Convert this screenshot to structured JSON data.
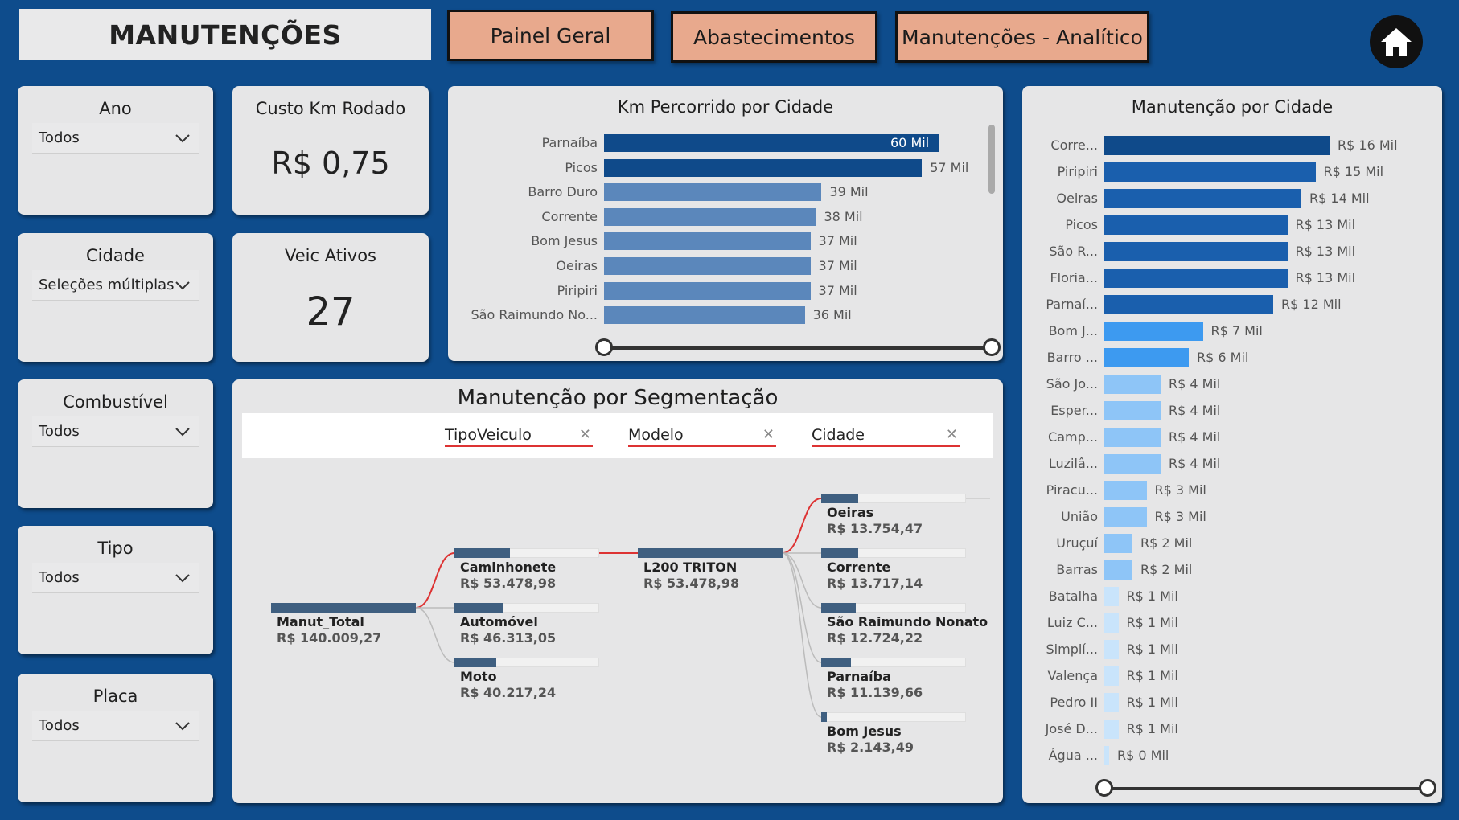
{
  "header": {
    "title": "MANUTENÇÕES",
    "nav": [
      "Painel Geral",
      "Abastecimentos",
      "Manutenções - Analítico"
    ]
  },
  "slicers": [
    {
      "title": "Ano",
      "value": "Todos"
    },
    {
      "title": "Cidade",
      "value": "Seleções múltiplas"
    },
    {
      "title": "Combustível",
      "value": "Todos"
    },
    {
      "title": "Tipo",
      "value": "Todos"
    },
    {
      "title": "Placa",
      "value": "Todos"
    }
  ],
  "kpis": [
    {
      "title": "Custo Km Rodado",
      "value": "R$ 0,75"
    },
    {
      "title": "Veic Ativos",
      "value": "27"
    }
  ],
  "km_chart": {
    "title": "Km Percorrido por Cidade",
    "labels": [
      "Parnaíba",
      "Picos",
      "Barro Duro",
      "Corrente",
      "Bom Jesus",
      "Oeiras",
      "Piripiri",
      "São Raimundo No..."
    ],
    "display": [
      "60 Mil",
      "57 Mil",
      "39 Mil",
      "38 Mil",
      "37 Mil",
      "37 Mil",
      "37 Mil",
      "36 Mil"
    ]
  },
  "manut_chart": {
    "title": "Manutenção por Cidade",
    "labels": [
      "Corre...",
      "Piripiri",
      "Oeiras",
      "Picos",
      "São R...",
      "Floria...",
      "Parnaí...",
      "Bom J...",
      "Barro ...",
      "São Jo...",
      "Esper...",
      "Camp...",
      "Luzilâ...",
      "Piracu...",
      "União",
      "Uruçuí",
      "Barras",
      "Batalha",
      "Luiz C...",
      "Simplí...",
      "Valença",
      "Pedro II",
      "José D...",
      "Água ..."
    ],
    "display": [
      "R$ 16 Mil",
      "R$ 15 Mil",
      "R$ 14 Mil",
      "R$ 13 Mil",
      "R$ 13 Mil",
      "R$ 13 Mil",
      "R$ 12 Mil",
      "R$ 7 Mil",
      "R$ 6 Mil",
      "R$ 4 Mil",
      "R$ 4 Mil",
      "R$ 4 Mil",
      "R$ 4 Mil",
      "R$ 3 Mil",
      "R$ 3 Mil",
      "R$ 2 Mil",
      "R$ 2 Mil",
      "R$ 1 Mil",
      "R$ 1 Mil",
      "R$ 1 Mil",
      "R$ 1 Mil",
      "R$ 1 Mil",
      "R$ 1 Mil",
      "R$ 0 Mil"
    ]
  },
  "decomposition": {
    "title": "Manutenção por Segmentação",
    "fields": [
      "TipoVeiculo",
      "Modelo",
      "Cidade"
    ],
    "root": {
      "name": "Manut_Total",
      "value": "R$ 140.009,27",
      "fraction": 1.0
    },
    "level1": [
      {
        "name": "Caminhonete",
        "value": "R$ 53.478,98",
        "fraction": 0.382
      },
      {
        "name": "Automóvel",
        "value": "R$ 46.313,05",
        "fraction": 0.331
      },
      {
        "name": "Moto",
        "value": "R$ 40.217,24",
        "fraction": 0.287
      }
    ],
    "level2": [
      {
        "name": "L200 TRITON",
        "value": "R$ 53.478,98",
        "fraction": 1.0
      }
    ],
    "level3": [
      {
        "name": "Oeiras",
        "value": "R$ 13.754,47",
        "fraction": 0.257
      },
      {
        "name": "Corrente",
        "value": "R$ 13.717,14",
        "fraction": 0.256
      },
      {
        "name": "São Raimundo Nonato",
        "value": "R$ 12.724,22",
        "fraction": 0.238
      },
      {
        "name": "Parnaíba",
        "value": "R$ 11.139,66",
        "fraction": 0.208
      },
      {
        "name": "Bom Jesus",
        "value": "R$ 2.143,49",
        "fraction": 0.04
      }
    ]
  },
  "chart_data": [
    {
      "type": "bar",
      "title": "Km Percorrido por Cidade",
      "categories": [
        "Parnaíba",
        "Picos",
        "Barro Duro",
        "Corrente",
        "Bom Jesus",
        "Oeiras",
        "Piripiri",
        "São Raimundo No..."
      ],
      "values": [
        60,
        57,
        39,
        38,
        37,
        37,
        37,
        36
      ],
      "xlim": [
        0,
        60
      ]
    },
    {
      "type": "bar",
      "title": "Manutenção por Cidade",
      "categories": [
        "Corre...",
        "Piripiri",
        "Oeiras",
        "Picos",
        "São R...",
        "Floria...",
        "Parnaí...",
        "Bom J...",
        "Barro ...",
        "São Jo...",
        "Esper...",
        "Camp...",
        "Luzilâ...",
        "Piracu...",
        "União",
        "Uruçuí",
        "Barras",
        "Batalha",
        "Luiz C...",
        "Simplí...",
        "Valença",
        "Pedro II",
        "José D...",
        "Água ..."
      ],
      "values": [
        16,
        15,
        14,
        13,
        13,
        13,
        12,
        7,
        6,
        4,
        4,
        4,
        4,
        3,
        3,
        2,
        2,
        1,
        1,
        1,
        1,
        1,
        1,
        0
      ],
      "xlim": [
        0,
        16
      ]
    }
  ]
}
